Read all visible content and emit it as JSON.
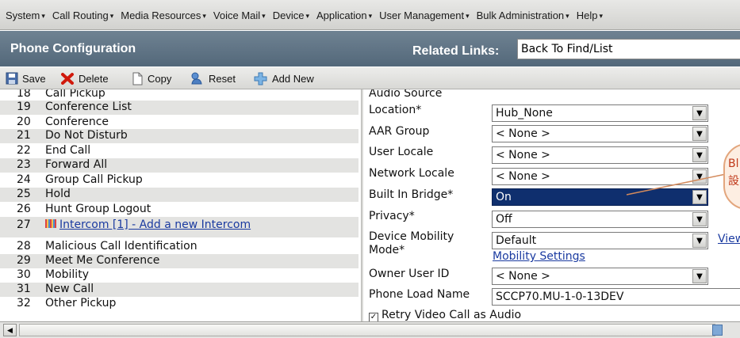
{
  "menu": {
    "items": [
      "System",
      "Call Routing",
      "Media Resources",
      "Voice Mail",
      "Device",
      "Application",
      "User Management",
      "Bulk Administration",
      "Help"
    ]
  },
  "header": {
    "title": "Phone Configuration",
    "related_label": "Related Links:",
    "related_value": "Back To Find/List"
  },
  "toolbar": {
    "save": "Save",
    "delete": "Delete",
    "copy": "Copy",
    "reset": "Reset",
    "add_new": "Add New"
  },
  "lines": [
    {
      "num": "18",
      "label": "Call Pickup"
    },
    {
      "num": "19",
      "label": "Conference List"
    },
    {
      "num": "20",
      "label": "Conference"
    },
    {
      "num": "21",
      "label": "Do Not Disturb"
    },
    {
      "num": "22",
      "label": "End Call"
    },
    {
      "num": "23",
      "label": "Forward All"
    },
    {
      "num": "24",
      "label": "Group Call Pickup"
    },
    {
      "num": "25",
      "label": "Hold"
    },
    {
      "num": "26",
      "label": "Hunt Group Logout"
    },
    {
      "num": "27",
      "label": "Intercom [1] - Add a new Intercom"
    },
    {
      "num": "28",
      "label": "Malicious Call Identification"
    },
    {
      "num": "29",
      "label": "Meet Me Conference"
    },
    {
      "num": "30",
      "label": "Mobility"
    },
    {
      "num": "31",
      "label": "New Call"
    },
    {
      "num": "32",
      "label": "Other Pickup"
    }
  ],
  "form": {
    "audio_source": "Audio Source",
    "location_label": "Location*",
    "location_value": "Hub_None",
    "aar_label": "AAR Group",
    "aar_value": "< None >",
    "locale_label": "User Locale",
    "locale_value": "< None >",
    "netlocale_label": "Network Locale",
    "netlocale_value": "< None >",
    "bridge_label": "Built In Bridge*",
    "bridge_value": "On",
    "privacy_label": "Privacy*",
    "privacy_value": "Off",
    "mobility_label_1": "Device Mobility",
    "mobility_label_2": "Mode*",
    "mobility_value": "Default",
    "view_link": "View",
    "mobility_settings_link": "Mobility Settings",
    "owner_label": "Owner User ID",
    "owner_value": "< None >",
    "load_label": "Phone Load Name",
    "load_value": "SCCP70.MU-1-0-13DEV",
    "retry_label": "Retry Video Call as Audio"
  },
  "callout": {
    "line1": "Bl",
    "line2": "設"
  },
  "colors": {
    "title_bar": "#5e7384",
    "highlight": "#0f2f6e",
    "link": "#1a3aa0"
  }
}
